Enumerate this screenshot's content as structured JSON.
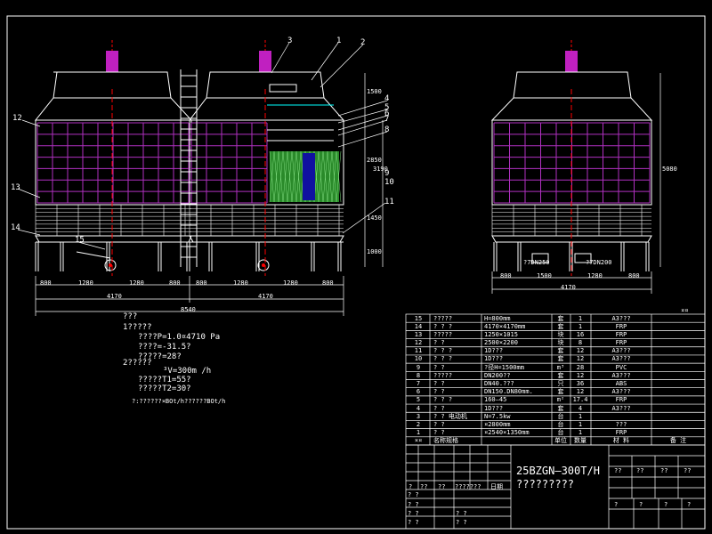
{
  "callouts": [
    "3",
    "1",
    "2",
    "4",
    "5",
    "6",
    "7",
    "8",
    "9",
    "10",
    "11",
    "12",
    "13",
    "14",
    "15"
  ],
  "front_dims": {
    "bottom": [
      "800",
      "1280",
      "1280",
      "800",
      "800",
      "1280",
      "1280",
      "800"
    ],
    "overall_halves": [
      "4170",
      "4170"
    ],
    "overall": "8540",
    "vertical": [
      "1500",
      "2850",
      "1450",
      "1000",
      "3190"
    ]
  },
  "side_dims": {
    "bottom": [
      "800",
      "1500",
      "1280",
      "800"
    ],
    "overall": "4170",
    "height": "5080",
    "pipes": [
      "?7DN250",
      "?7DN200"
    ]
  },
  "notes": {
    "l1": "???",
    "l2": "1?????",
    "l3": "????P=1.0¤4710  Pa",
    "l4": "????=-31.5?",
    "l5": "?????=28?",
    "l6": "2?????",
    "l7": "³V=300m  /h",
    "l8": "?????T1=55?",
    "l9": "?????T2=30?",
    "l10": "?:??????¤BOt/h??????BOt/h"
  },
  "bom": {
    "corner": "¤¤",
    "rows": [
      {
        "no": "15",
        "name": "?????",
        "spec": "H=800mm",
        "unit": "套",
        "qty": "1",
        "mat": "A3???",
        "note": ""
      },
      {
        "no": "14",
        "name": "?  ?  ?",
        "spec": "4170×4170mm",
        "unit": "套",
        "qty": "1",
        "mat": "FRP",
        "note": ""
      },
      {
        "no": "13",
        "name": "?????",
        "spec": "1250×1015",
        "unit": "块",
        "qty": "16",
        "mat": "FRP",
        "note": ""
      },
      {
        "no": "12",
        "name": "?  ?",
        "spec": "2500×2200",
        "unit": "块",
        "qty": "8",
        "mat": "FRP",
        "note": ""
      },
      {
        "no": "11",
        "name": "?  ?  ?",
        "spec": "1D???",
        "unit": "套",
        "qty": "12",
        "mat": "A3???",
        "note": ""
      },
      {
        "no": "10",
        "name": "?  ?  ?",
        "spec": "1D???",
        "unit": "套",
        "qty": "12",
        "mat": "A3???",
        "note": ""
      },
      {
        "no": "9",
        "name": "?  ?",
        "spec": "?径H=1500mm",
        "unit": "m³",
        "qty": "28",
        "mat": "PVC",
        "note": ""
      },
      {
        "no": "8",
        "name": "?????",
        "spec": "DN200??",
        "unit": "套",
        "qty": "12",
        "mat": "A3???",
        "note": ""
      },
      {
        "no": "7",
        "name": "?  ?",
        "spec": "DN40.???",
        "unit": "只",
        "qty": "36",
        "mat": "ABS",
        "note": ""
      },
      {
        "no": "6",
        "name": "?  ?",
        "spec": "DN150.DN80mm.",
        "unit": "套",
        "qty": "12",
        "mat": "A3???",
        "note": ""
      },
      {
        "no": "5",
        "name": "?  ?  ?",
        "spec": "160—45",
        "unit": "m²",
        "qty": "17.4",
        "mat": "FRP",
        "note": ""
      },
      {
        "no": "4",
        "name": "?  ?",
        "spec": "1D???",
        "unit": "套",
        "qty": "4",
        "mat": "A3???",
        "note": ""
      },
      {
        "no": "3",
        "name": "?  ?     电动机",
        "spec": "N=7.5kw",
        "unit": "台",
        "qty": "1",
        "mat": "",
        "note": ""
      },
      {
        "no": "2",
        "name": "?  ?",
        "spec": "¤2800mm",
        "unit": "台",
        "qty": "1",
        "mat": "???",
        "note": ""
      },
      {
        "no": "1",
        "name": "?  ?",
        "spec": "¤2540×1350mm",
        "unit": "台",
        "qty": "1",
        "mat": "FRP",
        "note": ""
      }
    ],
    "header": {
      "no": "¤¤",
      "name": "名称规格",
      "spec": "",
      "unit": "单位",
      "qty": "数量",
      "mat": "材  料",
      "note": "备    注"
    }
  },
  "title_block": {
    "model": "25BZGN—300T/H",
    "name": "?????????",
    "tr_labels": [
      "??",
      "??",
      "??",
      "??"
    ],
    "mid_labels": [
      "?",
      "??",
      "??",
      "?????",
      "??",
      "日期"
    ],
    "left_labels": [
      "? ?",
      "? ?",
      "? ?",
      "? ?",
      "? ?",
      "? ?"
    ],
    "bottom_q": [
      "?",
      "?",
      "?",
      "?"
    ]
  }
}
